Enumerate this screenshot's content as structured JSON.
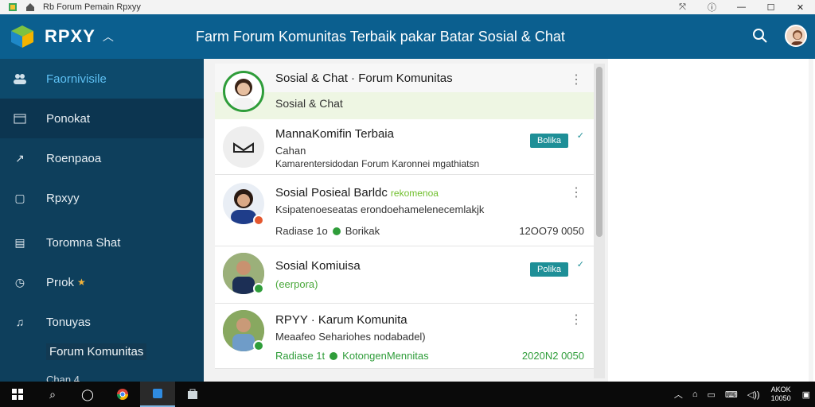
{
  "window": {
    "title": "Rb Forum Pemain Rpxyy",
    "controls": {
      "minimize": "—",
      "maximize": "☐",
      "close": "✕"
    }
  },
  "header": {
    "logo_text": "RPXY",
    "title": "Farm Forum Komunitas Terbaik pakar Batar Sosial & Chat"
  },
  "sidebar": {
    "items": [
      {
        "label": "Faornivisile",
        "icon": "group-icon"
      },
      {
        "label": "Ponokat",
        "icon": "calendar-icon"
      },
      {
        "label": "Roenpaoa",
        "icon": "share-icon"
      },
      {
        "label": "Rpxyy",
        "icon": "chat-icon"
      },
      {
        "label": "Toromna Shat",
        "icon": "inbox-icon"
      },
      {
        "label": "Prıok",
        "icon": "clock-icon"
      },
      {
        "label": "Tonuyas",
        "icon": "music-icon"
      }
    ],
    "sub_label": "Forum Komunitas",
    "sub_label2": "Chan 4"
  },
  "chats": [
    {
      "name": "Sosial & Chat · Forum Komunitas",
      "sub": "Sosial & Chat"
    },
    {
      "name": "MannaKomifin Terbaia",
      "sub": "Cahan",
      "preview": "Kamarentersidodan Forum Karonnei mgathiatsn",
      "badge": "Bolika"
    },
    {
      "name": "Sosial Posieal Barldc",
      "tag": "rekomenoa",
      "preview": "Ksipatenoeseatas erondoehamelenecemlakjk",
      "meta": "Radiase 1o",
      "meta2": "Borikak",
      "time": "12OO79 0050"
    },
    {
      "name": "Sosial Komiuisa",
      "sub": "(eerpora)",
      "badge": "Polika"
    },
    {
      "name": "RPYY · Karum Komunita",
      "preview": "Meaafeo Sehariohes nodabadel)",
      "meta": "Radiase 1t",
      "meta2": "KotongenMennitas",
      "time": "2020N2 0050"
    }
  ],
  "taskbar": {
    "clock_time": "AKOK",
    "clock_date": "10050"
  }
}
